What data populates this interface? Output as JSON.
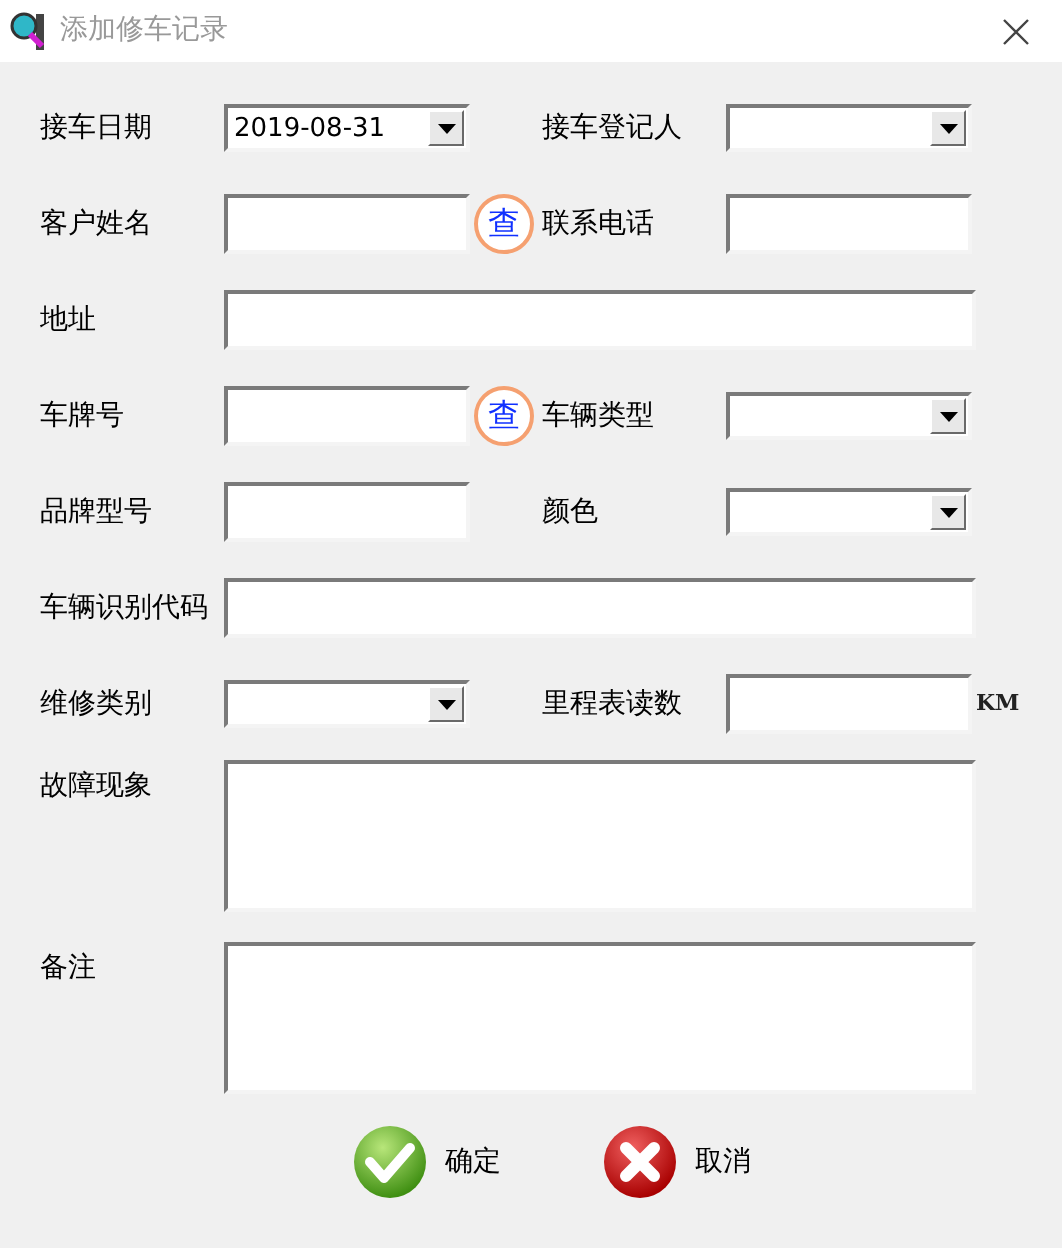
{
  "window": {
    "title": "添加修车记录"
  },
  "rows": [
    {
      "label": "接车日期",
      "field": {
        "kind": "dropdown",
        "value": "2019-08-31"
      },
      "right": {
        "label": "接车登记人",
        "field": {
          "kind": "dropdown"
        }
      }
    },
    {
      "label": "客户姓名",
      "field": {
        "kind": "text"
      },
      "lookup": "查",
      "right": {
        "label": "联系电话",
        "field": {
          "kind": "text"
        }
      }
    },
    {
      "label": "地址",
      "field": {
        "kind": "wide"
      }
    },
    {
      "label": "车牌号",
      "field": {
        "kind": "text"
      },
      "lookup": "查",
      "right": {
        "label": "车辆类型",
        "field": {
          "kind": "dropdown"
        }
      }
    },
    {
      "label": "品牌型号",
      "field": {
        "kind": "text"
      },
      "right": {
        "label": "颜色",
        "field": {
          "kind": "dropdown"
        }
      }
    },
    {
      "label": "车辆识别代码",
      "field": {
        "kind": "wide"
      }
    },
    {
      "label": "维修类别",
      "field": {
        "kind": "dropdown"
      },
      "right": {
        "label": "里程表读数",
        "field": {
          "kind": "text"
        },
        "unit": "KM"
      }
    },
    {
      "label": "故障现象",
      "field": {
        "kind": "textarea"
      }
    },
    {
      "label": "备注",
      "field": {
        "kind": "textarea"
      }
    }
  ],
  "buttons": [
    {
      "label": "确定",
      "kind": "ok"
    },
    {
      "label": "取消",
      "kind": "cancel"
    }
  ]
}
